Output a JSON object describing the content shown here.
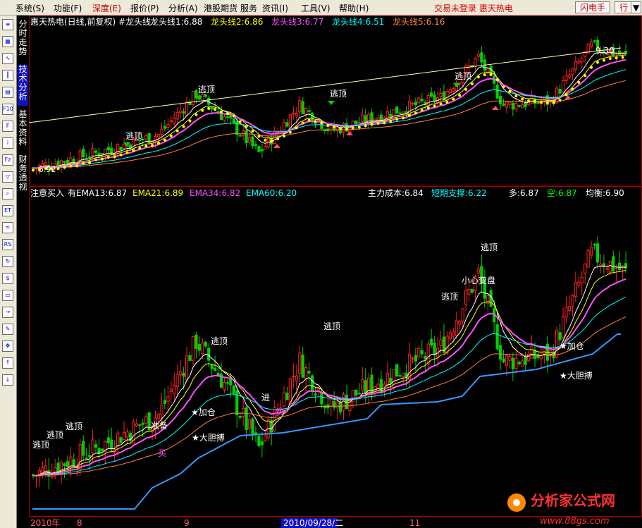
{
  "menu": {
    "items": [
      "系统(S)",
      "功能(F)",
      "深度(E)",
      "报价(P)",
      "分析(A)",
      "港股期货",
      "服务",
      "资讯(I)",
      "工具(V)",
      "帮助(H)"
    ],
    "status": "交易未登录  惠天热电",
    "flash_button": "闪电手",
    "quote_button": "行",
    "restore_button": "▼"
  },
  "side_tabs": [
    "分时走势",
    "技术分析",
    "基本资料",
    "财务透视"
  ],
  "toolbar_icons": [
    "list-icon",
    "grid-icon",
    "line-chart-icon",
    "kline-icon",
    "table-icon",
    "f10-icon",
    "f10-detail-icon",
    "info-icon",
    "fiz-icon",
    "filter-icon",
    "search-icon",
    "eti-icon",
    "wave-icon",
    "rsi-icon",
    "refresh-icon",
    "money-icon",
    "ticket-icon",
    "export-icon",
    "pencil-icon",
    "move-icon",
    "arrow-up-icon",
    "arrow-down-icon"
  ],
  "upper": {
    "title": "惠天热电(日线,前复权) #龙头线",
    "lines": [
      {
        "label": "龙头线1:6.88",
        "color": "#ffffff"
      },
      {
        "label": "龙头线2:6.86",
        "color": "#ffff00"
      },
      {
        "label": "龙头线3:6.77",
        "color": "#ff50ff"
      },
      {
        "label": "龙头线4:6.51",
        "color": "#00ffff"
      },
      {
        "label": "龙头线5:6.16",
        "color": "#ff8040"
      }
    ],
    "high_label": "9.30",
    "low_label": "5.92",
    "escape_labels": [
      "逃顶",
      "逃顶",
      "逃顶",
      "逃顶"
    ]
  },
  "lower": {
    "title": "注意买入",
    "ema": [
      {
        "label": "有EMA13:6.87",
        "color": "#ffffff"
      },
      {
        "label": "EMA21:6.89",
        "color": "#ffff00"
      },
      {
        "label": "EMA34:6.82",
        "color": "#ff50ff"
      },
      {
        "label": "EMA60:6.20",
        "color": "#00ffff"
      }
    ],
    "right": [
      {
        "label": "主力成本:6.84",
        "color": "#ffffff"
      },
      {
        "label": "短期支撑:6.22",
        "color": "#00ffff"
      },
      {
        "label": "多:6.87",
        "color": "#ffffff"
      },
      {
        "label": "空:6.87",
        "color": "#00ff00"
      },
      {
        "label": "均衡:6.90",
        "color": "#ffffff"
      }
    ],
    "signals": {
      "escape": "逃顶",
      "add": "★加仓",
      "bold": "★大胆搏",
      "prepare": "准备",
      "buy": "买",
      "caution": "小心变盘",
      "enter": "进"
    }
  },
  "date_axis": {
    "year": "2010年",
    "months": [
      "8",
      "9",
      "11"
    ],
    "cursor_date": "2010/09/28/二"
  },
  "watermark": {
    "name": "分析家公式网",
    "url": "www.88gs.com"
  },
  "colors": {
    "up": "#ff2020",
    "down": "#00d000",
    "grid": "#a00000",
    "bg": "#000000"
  }
}
